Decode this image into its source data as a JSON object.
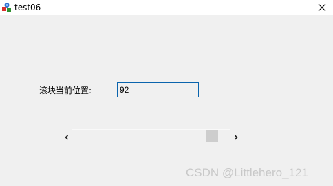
{
  "window": {
    "title": "test06",
    "app_icon": "app-icon",
    "close_icon": "close-icon"
  },
  "form": {
    "label": "滚块当前位置:",
    "position_value": "92"
  },
  "scrollbar": {
    "min": 0,
    "max": 100,
    "position": 92,
    "left_arrow_icon": "chevron-left-icon",
    "right_arrow_icon": "chevron-right-icon"
  },
  "watermark": {
    "text": "CSDN @Littlehero_121"
  },
  "colors": {
    "edit_border": "#0a64ad",
    "thumb": "#cdcdcd",
    "background": "#f0f0f0"
  }
}
